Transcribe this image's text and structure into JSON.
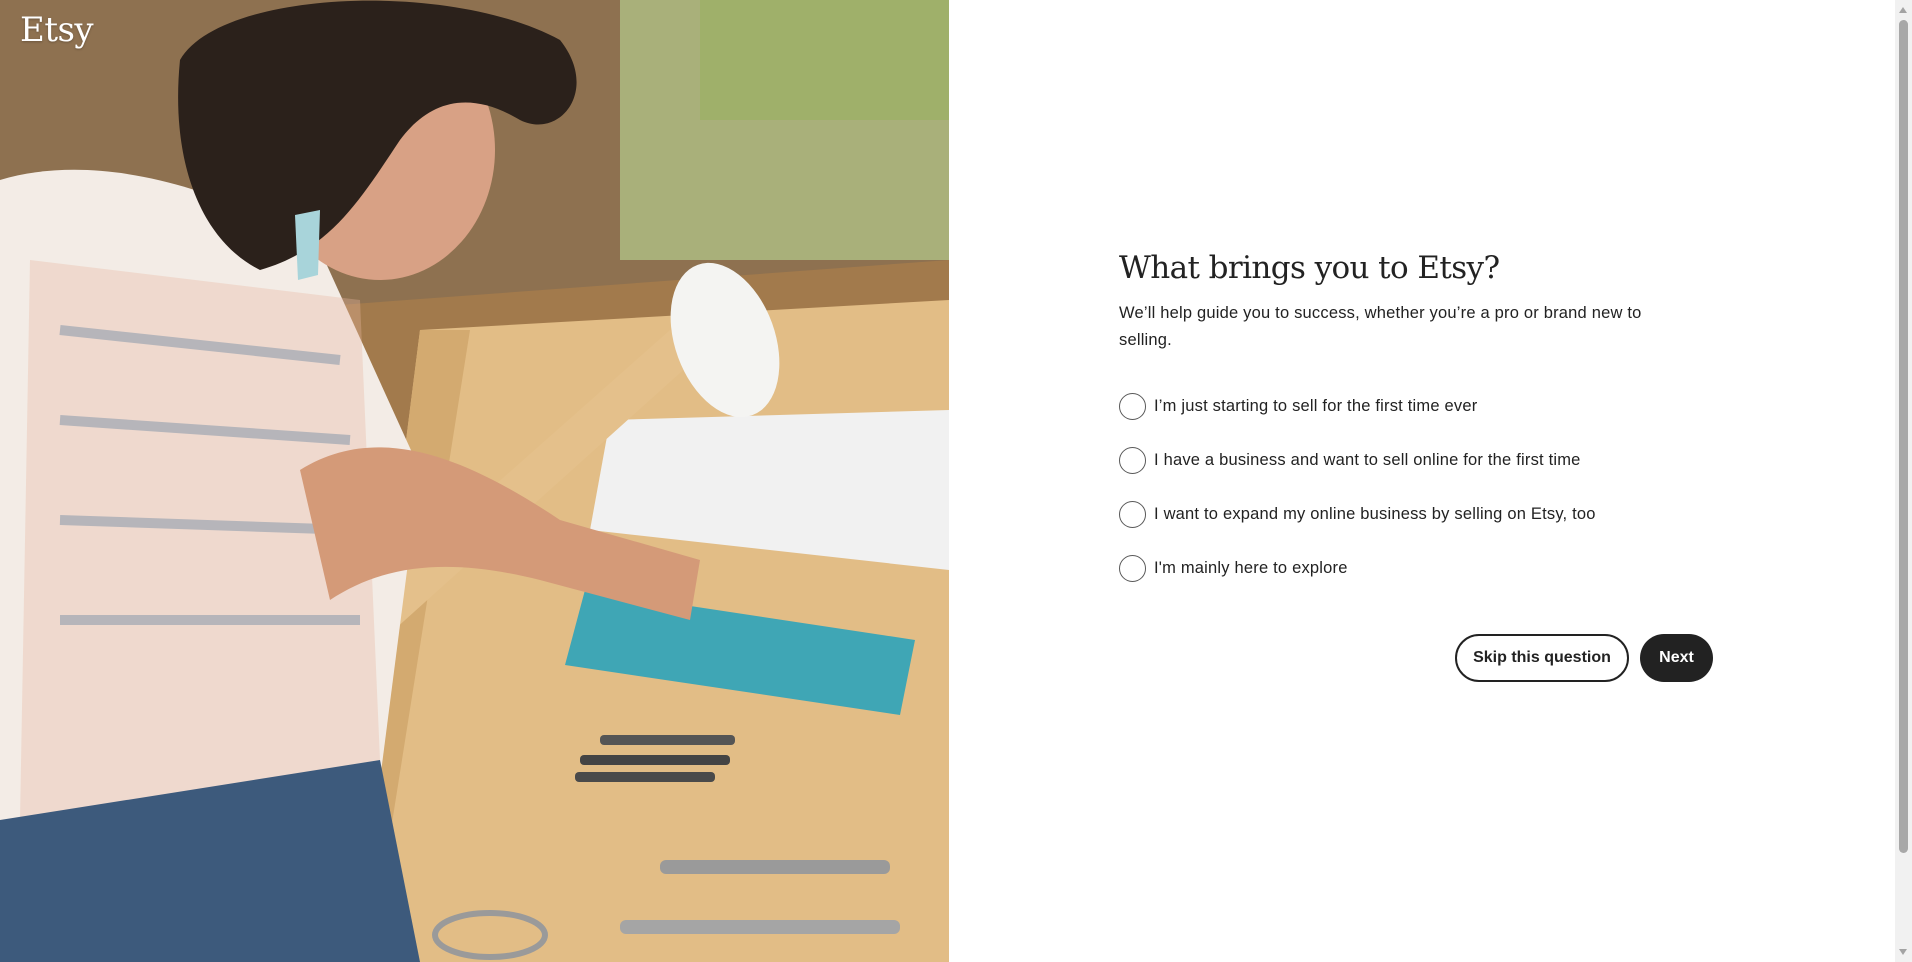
{
  "brand": {
    "logo_text": "Etsy"
  },
  "hero": {
    "image_icon": "artisan-photo"
  },
  "question": {
    "title": "What brings you to Etsy?",
    "subtitle": "We’ll help guide you to success, whether you’re a pro or brand new to selling.",
    "options": [
      {
        "label": "I’m just starting to sell for the first time ever",
        "selected": false
      },
      {
        "label": "I have a business and want to sell online for the first time",
        "selected": false
      },
      {
        "label": "I want to expand my online business by selling on Etsy, too",
        "selected": false
      },
      {
        "label": "I'm mainly here to explore",
        "selected": false
      }
    ]
  },
  "actions": {
    "skip_label": "Skip this question",
    "next_label": "Next"
  },
  "colors": {
    "primary_button": "#222222",
    "text": "#222222",
    "radio_border": "#595959"
  }
}
